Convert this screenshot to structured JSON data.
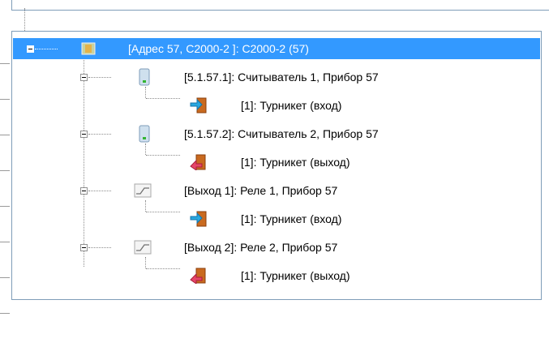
{
  "tree": {
    "root": {
      "label": "[Адрес 57, С2000-2 ]: С2000-2 (57)",
      "icon": "device-icon"
    },
    "children": [
      {
        "label": "[5.1.57.1]: Считыватель 1, Прибор 57",
        "icon": "reader-icon",
        "child": {
          "label": "[1]: Турникет (вход)",
          "icon": "entry-door-icon"
        }
      },
      {
        "label": "[5.1.57.2]: Считыватель 2, Прибор 57",
        "icon": "reader-icon",
        "child": {
          "label": "[1]: Турникет (выход)",
          "icon": "exit-door-icon"
        }
      },
      {
        "label": "[Выход 1]: Реле 1, Прибор 57",
        "icon": "relay-icon",
        "child": {
          "label": "[1]: Турникет (вход)",
          "icon": "entry-door-icon"
        }
      },
      {
        "label": "[Выход 2]: Реле 2, Прибор 57",
        "icon": "relay-icon",
        "child": {
          "label": "[1]: Турникет (выход)",
          "icon": "exit-door-icon"
        }
      }
    ]
  },
  "colors": {
    "selection": "#3399ff",
    "border": "#7f9db9"
  }
}
